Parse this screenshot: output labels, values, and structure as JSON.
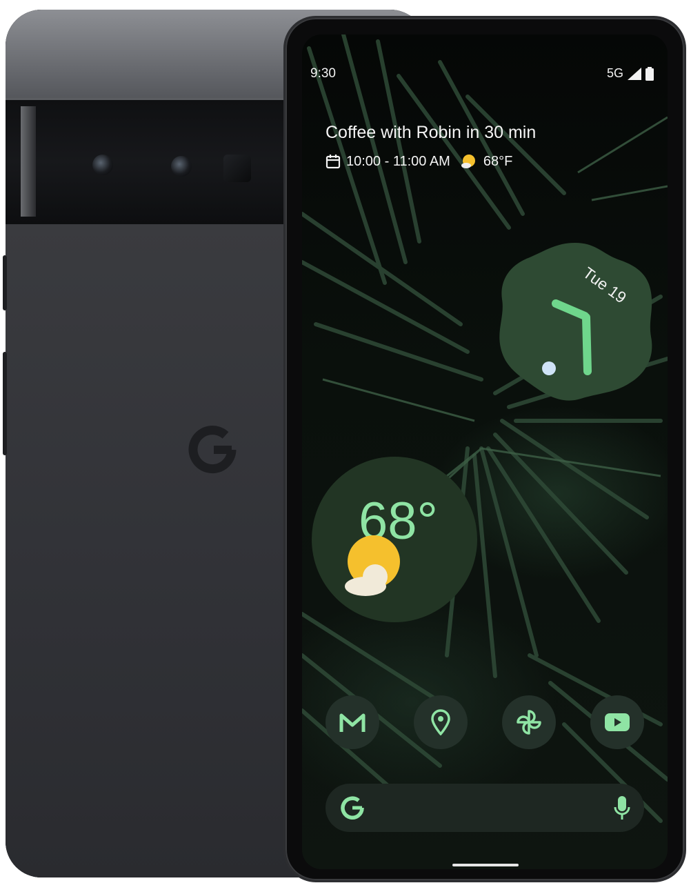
{
  "status_bar": {
    "time": "9:30",
    "network": "5G"
  },
  "at_a_glance": {
    "event_title": "Coffee with Robin in 30 min",
    "event_time": "10:00 - 11:00 AM",
    "temperature": "68°F",
    "calendar_icon": "calendar-icon",
    "weather_icon": "sun-cloud-icon"
  },
  "clock_widget": {
    "date": "Tue 19"
  },
  "weather_widget": {
    "temperature": "68°"
  },
  "dock": {
    "apps": [
      {
        "name": "gmail",
        "icon": "gmail-icon"
      },
      {
        "name": "maps",
        "icon": "maps-pin-icon"
      },
      {
        "name": "photos",
        "icon": "pinwheel-icon"
      },
      {
        "name": "youtube",
        "icon": "youtube-icon"
      }
    ]
  },
  "search_bar": {
    "logo_icon": "google-g-icon",
    "mic_icon": "mic-icon"
  },
  "colors": {
    "accent_green": "#8fe4a4",
    "widget_green": "#223524",
    "sun_yellow": "#f5c02d"
  }
}
